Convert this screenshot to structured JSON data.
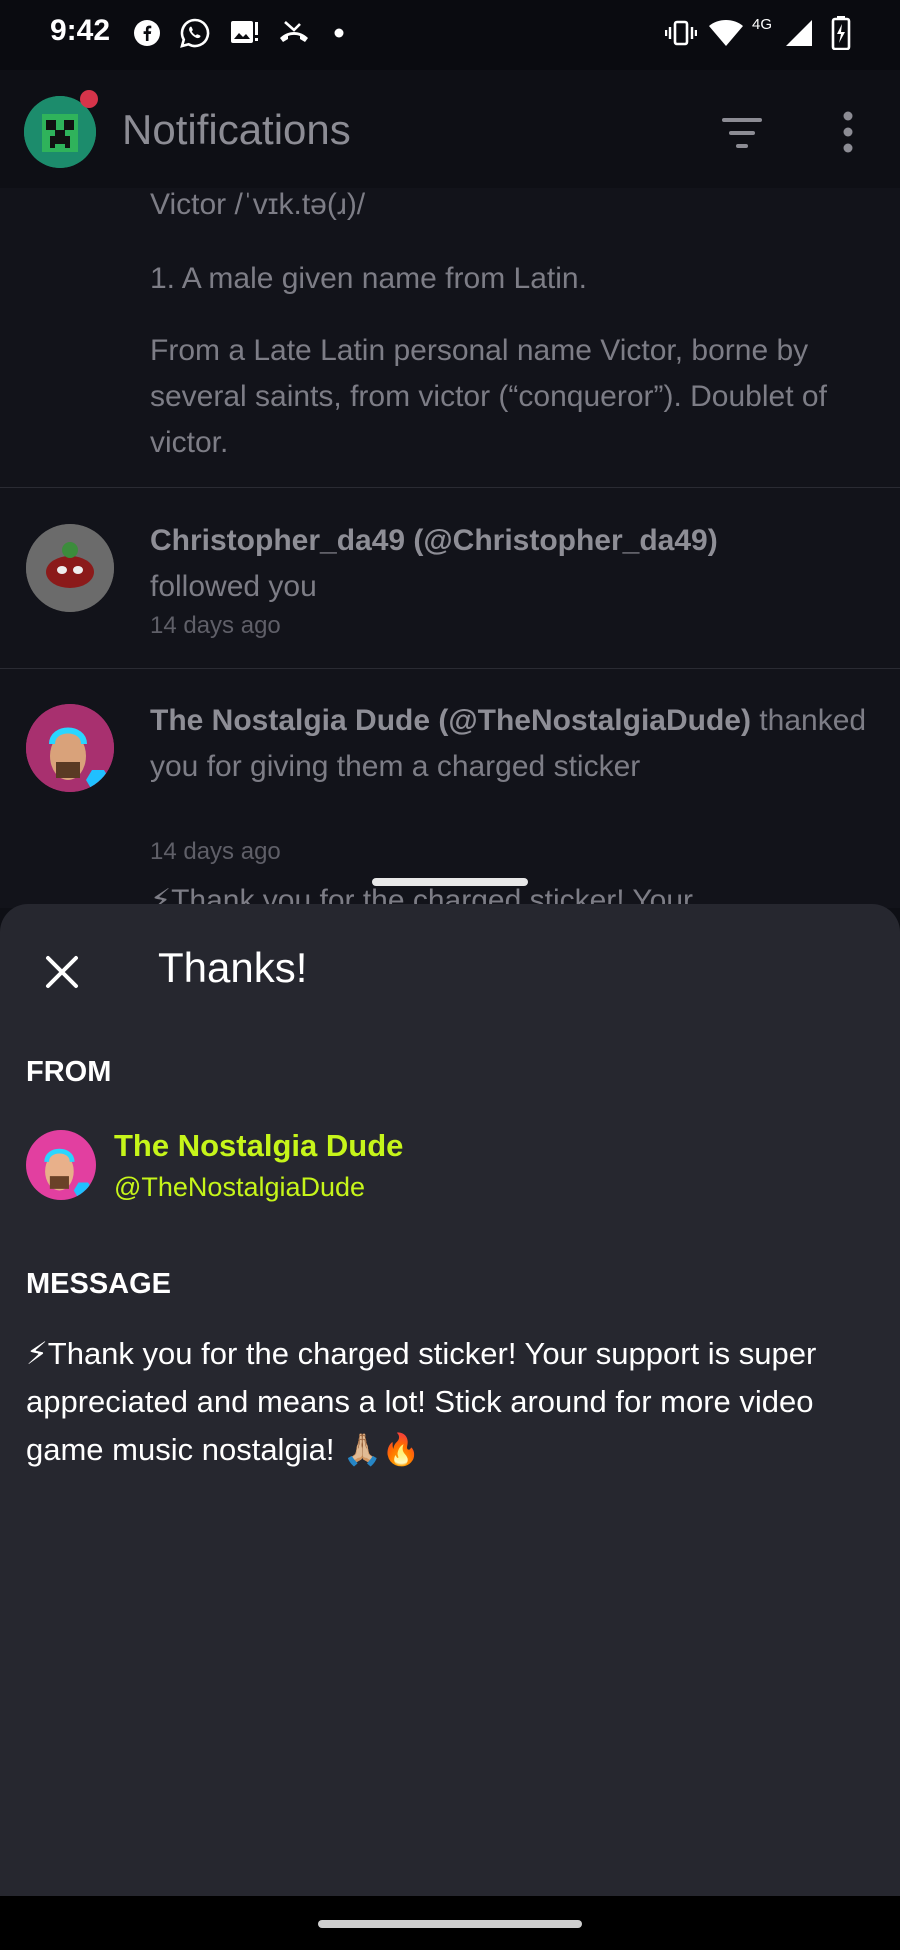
{
  "status_bar": {
    "time": "9:42",
    "network": "4G",
    "icons": [
      "facebook-icon",
      "whatsapp-icon",
      "image-alert-icon",
      "missed-call-icon",
      "dot-icon",
      "vibrate-icon",
      "wifi-icon",
      "signal-icon",
      "battery-charging-icon"
    ]
  },
  "app_bar": {
    "title": "Notifications",
    "icons": [
      "creeper-avatar-icon",
      "filter-icon",
      "more-vert-icon"
    ]
  },
  "feed": {
    "definition": {
      "pronunciation": "Victor /ˈvɪk.tə(ɹ)/",
      "sense": "1.  A male given name from Latin.",
      "etymology": "From a Late Latin personal name Victor, borne by several saints, from victor (“conqueror”). Doublet of victor."
    },
    "items": [
      {
        "user": "Christopher_da49 (@Christopher_da49)",
        "action": "followed you",
        "time": "14 days ago"
      },
      {
        "user": "The Nostalgia Dude (@TheNostalgiaDude)",
        "action": " thanked you for giving them a charged sticker",
        "time": "14 days ago"
      }
    ],
    "peek_text": "⚡Thank you for the charged sticker! Your"
  },
  "sheet": {
    "title": "Thanks!",
    "from_label": "FROM",
    "from_name": "The Nostalgia Dude",
    "from_handle": "@TheNostalgiaDude",
    "message_label": "MESSAGE",
    "message": "⚡Thank you for the charged sticker! Your support is super appreciated and means a lot! Stick around for more video game music nostalgia! 🙏🏼🔥"
  },
  "colors": {
    "accent_name": "#c6f51a",
    "sheet_bg": "#26272f",
    "background": "#0e0f15"
  }
}
